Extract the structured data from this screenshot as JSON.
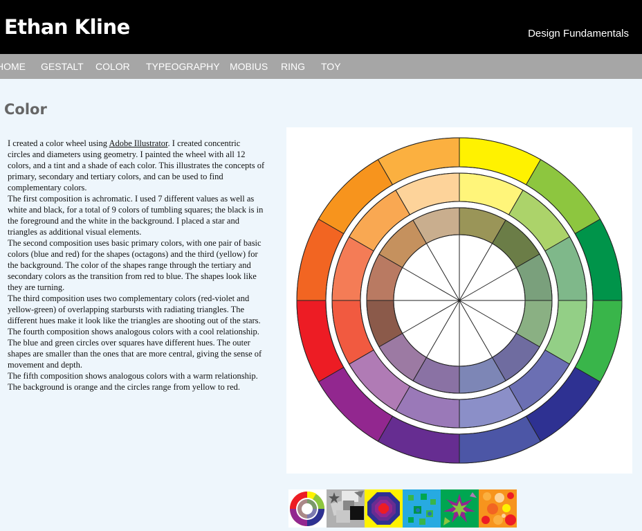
{
  "header": {
    "site_title": "Ethan Kline",
    "tagline": "Design Fundamentals"
  },
  "nav": {
    "items": [
      "HOME",
      "GESTALT",
      "COLOR",
      "TYPEOGRAPHY",
      "MOBIUS",
      "RING",
      "TOY"
    ]
  },
  "main": {
    "title": "Color",
    "paragraphs": [
      {
        "before": "I created a color wheel using ",
        "link": "Adobe Illustrator",
        "after": ".  I created concentric circles and diameters using geometry.  I painted the wheel with all 12 colors, and a tint and a shade of each color.  This illustrates the concepts of primary, secondary and tertiary colors, and can be used to find complementary colors."
      },
      {
        "text": "The first composition is achromatic.  I used 7 different values as well as white and black, for a total of 9 colors of tumbling squares; the black is in the foreground and the white in the background.  I placed a star and triangles as additional visual elements."
      },
      {
        "text": "The second composition uses basic primary colors, with one pair of basic colors (blue and red) for the shapes (octagons) and the third (yellow) for the background. The color of the shapes range through the tertiary and secondary colors as the transition from red to blue. The shapes look like they are turning."
      },
      {
        "text": "The third composition uses two complementary colors (red-violet and yellow-green) of overlapping starbursts with radiating triangles.  The different hues make it look like the triangles are shooting out of the stars."
      },
      {
        "text": "The fourth composition shows analogous colors with a cool relationship. The blue and green circles over squares have different hues.  The outer shapes are smaller than the ones that are more central, giving the sense of movement and depth."
      },
      {
        "text": "The fifth composition shows analogous colors with a warm relationship. The background is orange and the circles range from yellow to red."
      }
    ]
  },
  "wheel": {
    "outer": [
      "#fff200",
      "#8dc63f",
      "#00944a",
      "#39b54a",
      "#2e3192",
      "#4c56a6",
      "#662d91",
      "#92278f",
      "#ed1c24",
      "#f26522",
      "#f7941d",
      "#fbb040"
    ],
    "tint": [
      "#fff57a",
      "#acd36a",
      "#7fb88a",
      "#93cf86",
      "#6b6fb3",
      "#8b8fc8",
      "#9a79b8",
      "#b07bb5",
      "#f15a40",
      "#f47c56",
      "#f9a852",
      "#fdd39a"
    ],
    "shade": [
      "#9a9558",
      "#6b7d47",
      "#7aa07c",
      "#8ab083",
      "#6f6ca0",
      "#7d86b6",
      "#8a72a4",
      "#9c7aa3",
      "#8b5a4a",
      "#b97a62",
      "#c5915e",
      "#c9ae8e"
    ]
  },
  "thumbnails": [
    {
      "name": "color-wheel",
      "bg": "#ffffff"
    },
    {
      "name": "achromatic",
      "bg": "#a8a8a8"
    },
    {
      "name": "primary-colors",
      "bg": "#fff200"
    },
    {
      "name": "complementary",
      "bg": "#27aae1"
    },
    {
      "name": "cool-analogous",
      "bg": "#00a651"
    },
    {
      "name": "warm-analogous",
      "bg": "#f7941d"
    }
  ]
}
